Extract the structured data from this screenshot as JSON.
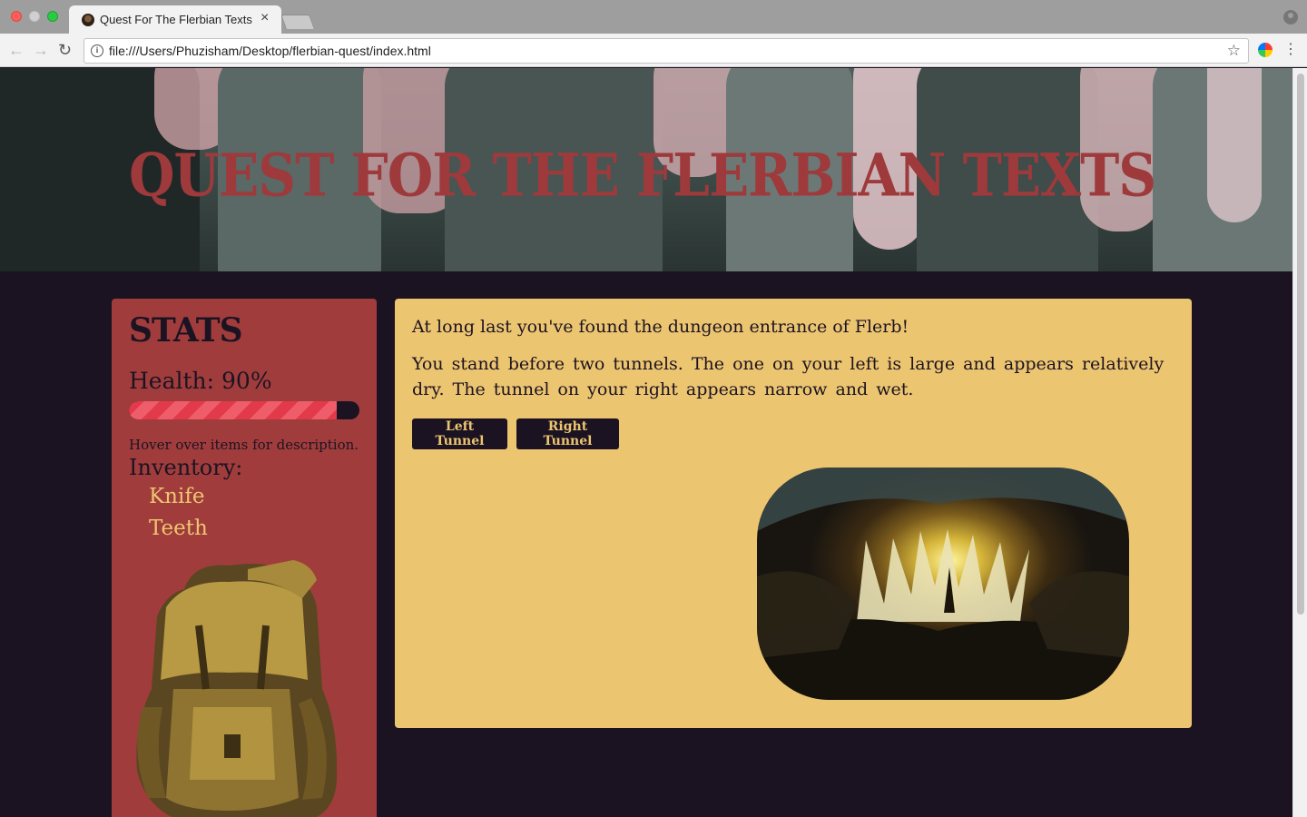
{
  "browser": {
    "tab_title": "Quest For The Flerbian Texts",
    "tab_close": "×",
    "url": "file:///Users/Phuzisham/Desktop/flerbian-quest/index.html",
    "back_glyph": "←",
    "forward_glyph": "→",
    "reload_glyph": "↻",
    "info_glyph": "i",
    "star_glyph": "☆",
    "menu_glyph": "⋮"
  },
  "header": {
    "title": "Quest For The Flerbian Texts"
  },
  "stats": {
    "heading": "Stats",
    "health_label": "Health: 90%",
    "health_value": 0.9,
    "hint": "Hover over items for description.",
    "inventory_heading": "Inventory:",
    "inventory": [
      "Knife",
      "Teeth"
    ]
  },
  "story": {
    "paragraph_1": "At long last you've found the dungeon entrance of Flerb!",
    "paragraph_2": "You stand before two tunnels. The one on your left is large and appears relatively dry. The tunnel on your right appears narrow and wet.",
    "choices": [
      "Left Tunnel",
      "Right Tunnel"
    ]
  },
  "colors": {
    "page_bg": "#1c1322",
    "title_red": "#9e3a3b",
    "stats_bg": "#a03d3c",
    "story_bg": "#ecc570",
    "item_gold": "#eec571",
    "health_stripe": "#e23a4a"
  }
}
